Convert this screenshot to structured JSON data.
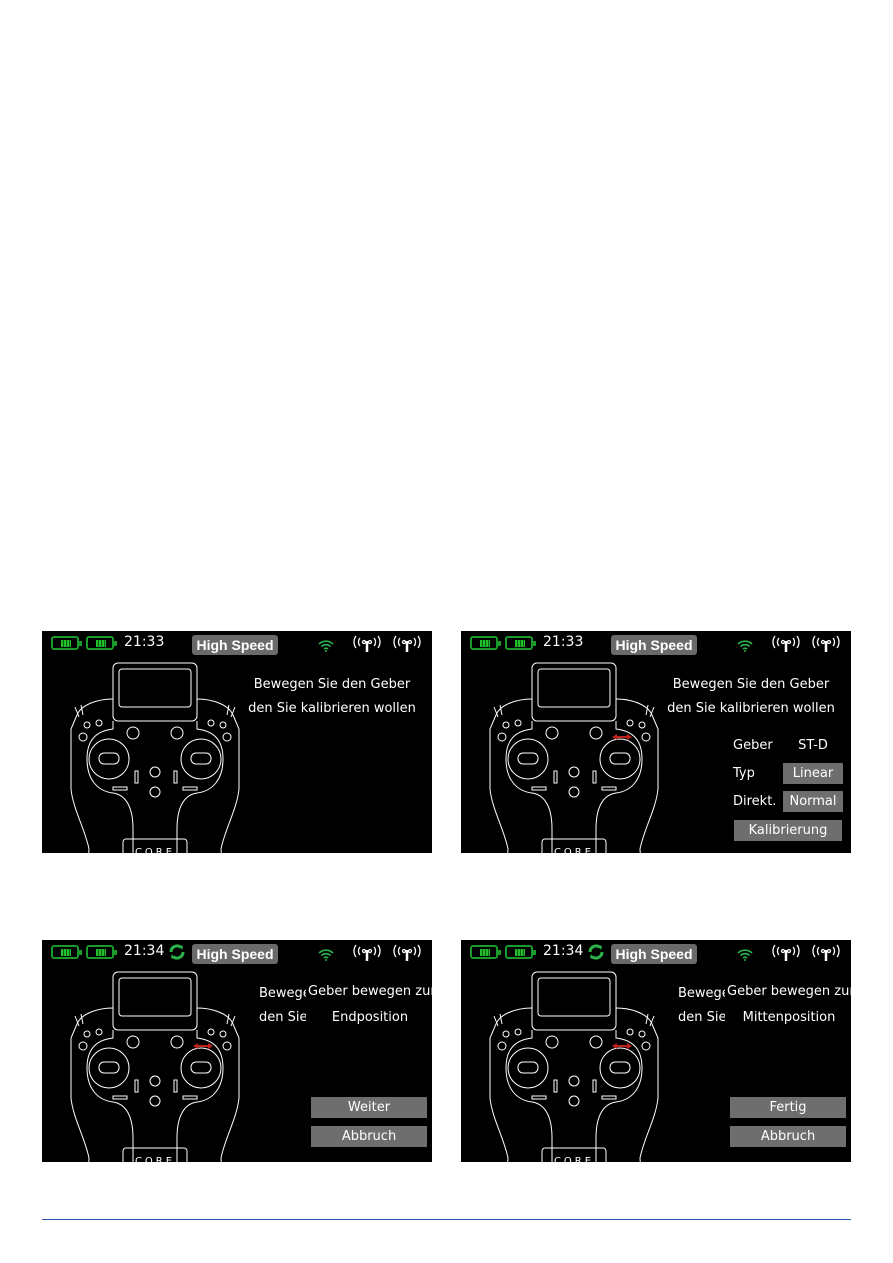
{
  "screens": [
    {
      "time": "21:33",
      "mode": "High Speed",
      "refresh": false,
      "arrows": false,
      "lines": [
        "Bewegen Sie den Geber",
        "den Sie kalibrieren wollen"
      ]
    },
    {
      "time": "21:33",
      "mode": "High Speed",
      "refresh": false,
      "arrows": true,
      "lines": [
        "Bewegen Sie den Geber",
        "den Sie kalibrieren wollen"
      ],
      "fields": {
        "geber_label": "Geber",
        "geber_value": "ST-D",
        "typ_label": "Typ",
        "typ_value": "Linear",
        "direkt_label": "Direkt.",
        "direkt_value": "Normal",
        "calibrate_button": "Kalibrierung"
      }
    },
    {
      "time": "21:34",
      "mode": "High Speed",
      "refresh": true,
      "arrows": true,
      "lines": [
        "Bewege",
        "den Sie"
      ],
      "dialog": {
        "line1": "Geber bewegen zur",
        "line2": "Endposition",
        "button1": "Weiter",
        "button2": "Abbruch"
      }
    },
    {
      "time": "21:34",
      "mode": "High Speed",
      "refresh": true,
      "arrows": true,
      "lines": [
        "Bewege",
        "den Sie"
      ],
      "dialog": {
        "line1": "Geber bewegen zur",
        "line2": "Mittenposition",
        "button1": "Fertig",
        "button2": "Abbruch"
      }
    }
  ],
  "icons": {
    "battery": "battery-icon",
    "refresh": "refresh-icon",
    "wifi": "wifi-icon",
    "antenna": "antenna-icon",
    "transmitter": "transmitter-illustration"
  },
  "colors": {
    "battery": "#22c02a",
    "accent_line": "#2c5da8",
    "button": "#6e6e6e",
    "arrow": "#c0201a"
  },
  "logo_text": "CORE"
}
